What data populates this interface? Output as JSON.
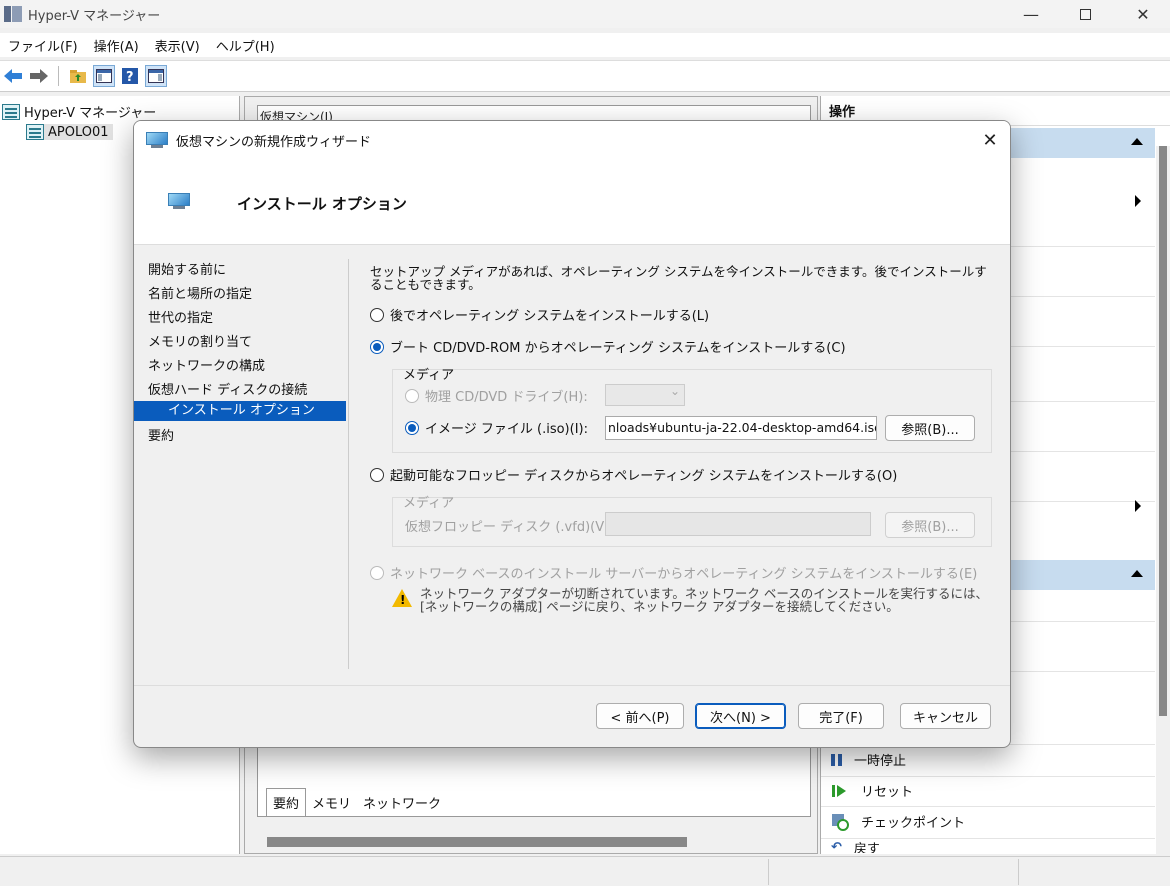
{
  "window": {
    "title": "Hyper-V マネージャー"
  },
  "menu": [
    "ファイル(F)",
    "操作(A)",
    "表示(V)",
    "ヘルプ(H)"
  ],
  "tree": {
    "root": "Hyper-V マネージャー",
    "server": "APOLO01"
  },
  "center": {
    "vm_header": "仮想マシン(I)",
    "tabs": [
      "要約",
      "メモリ",
      "ネットワーク"
    ]
  },
  "actions": {
    "header": "操作",
    "items": [
      {
        "icon": "pause-icon",
        "label": "一時停止"
      },
      {
        "icon": "reset-icon",
        "label": "リセット"
      },
      {
        "icon": "checkpoint-icon",
        "label": "チェックポイント"
      },
      {
        "icon": "revert-icon",
        "label": "戻す"
      }
    ]
  },
  "wizard": {
    "title": "仮想マシンの新規作成ウィザード",
    "heading": "インストール オプション",
    "nav": [
      "開始する前に",
      "名前と場所の指定",
      "世代の指定",
      "メモリの割り当て",
      "ネットワークの構成",
      "仮想ハード ディスクの接続",
      "インストール オプション",
      "要約"
    ],
    "nav_selected": 6,
    "description": "セットアップ メディアがあれば、オペレーティング システムを今インストールできます。後でインストールすることもできます。",
    "options": {
      "later": "後でオペレーティング システムをインストールする(L)",
      "cd": "ブート CD/DVD-ROM からオペレーティング システムをインストールする(C)",
      "floppy": "起動可能なフロッピー ディスクからオペレーティング システムをインストールする(O)",
      "network": "ネットワーク ベースのインストール サーバーからオペレーティング システムをインストールする(E)"
    },
    "selected_option": "cd",
    "media_label": "メディア",
    "physical_drive": "物理 CD/DVD ドライブ(H):",
    "image_file": "イメージ ファイル (.iso)(I):",
    "image_path": "nloads¥ubuntu-ja-22.04-desktop-amd64.iso",
    "browse": "参照(B)...",
    "floppy_media_label": "メディア",
    "floppy_file": "仮想フロッピー ディスク (.vfd)(V):",
    "floppy_browse": "参照(B)...",
    "warning": "ネットワーク アダプターが切断されています。ネットワーク ベースのインストールを実行するには、[ネットワークの構成] ページに戻り、ネットワーク アダプターを接続してください。",
    "buttons": {
      "prev": "< 前へ(P)",
      "next": "次へ(N) >",
      "finish": "完了(F)",
      "cancel": "キャンセル"
    }
  },
  "colors": {
    "accent": "#0a5cbd",
    "section_bar": "#c7dcef",
    "warning": "#f2b900"
  }
}
